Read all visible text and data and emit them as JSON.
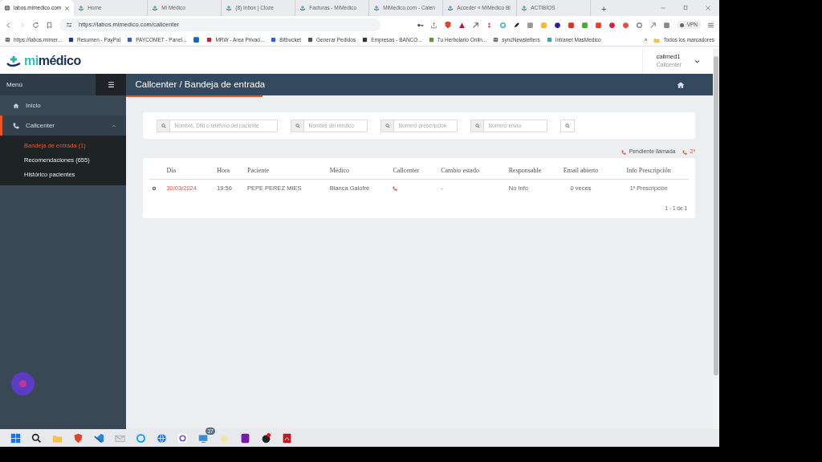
{
  "browser": {
    "tabs": [
      {
        "title": "labos.mimedico.com",
        "selected": true
      },
      {
        "title": "Home",
        "selected": false
      },
      {
        "title": "Mi Médico",
        "selected": false
      },
      {
        "title": "(8) Inbox | Cloze",
        "selected": false
      },
      {
        "title": "Facturas - MiMedico",
        "selected": false
      },
      {
        "title": "MiMedico.com - Calen",
        "selected": false
      },
      {
        "title": "Acceder « MiMedico Bl",
        "selected": false
      },
      {
        "title": "ACTIBIOS",
        "selected": false
      }
    ],
    "new_tab": "+",
    "url": "https://labos.mimedico.com/callcenter",
    "vpn": "VPN",
    "bookmarks": [
      {
        "label": "https://labos.mimer..."
      },
      {
        "label": "Resumen - PayPal"
      },
      {
        "label": "PAYCOMET - Panel..."
      },
      {
        "kind": "icon_only"
      },
      {
        "label": "MRW - Area Privad..."
      },
      {
        "label": "Bitbucket"
      },
      {
        "label": "Generar Pedidos"
      },
      {
        "label": "Empresas - BANCO..."
      },
      {
        "label": "Tu Herbolario Onlin..."
      },
      {
        "label": "syncNewsletters"
      },
      {
        "label": "Intranet MasMedico"
      }
    ],
    "more_bookmarks": "»",
    "all_bookmarks": "Todos los marcadores"
  },
  "app": {
    "logo_prefix": "mi",
    "logo_name": "médico",
    "user": {
      "name": "callmed1",
      "role": "Callcenter"
    },
    "sidebar": {
      "title": "Menú",
      "items": [
        {
          "label": "Inicio",
          "kind": "home",
          "selected": false
        },
        {
          "label": "Callcenter",
          "kind": "phone",
          "selected": true,
          "expanded": true,
          "children": [
            {
              "label": "Bandeja de entrada (1)",
              "selected": true
            },
            {
              "label": "Recomendaciones (655)",
              "selected": false
            },
            {
              "label": "Histórico pacientes",
              "selected": false
            }
          ]
        }
      ]
    },
    "page_title": "Callcenter / Bandeja de entrada",
    "filters": [
      {
        "placeholder": "Nombre, DNI o teléfono del paciente"
      },
      {
        "placeholder": "Nombre del médico"
      },
      {
        "placeholder": "Número prescripción"
      },
      {
        "placeholder": "Número envío"
      }
    ],
    "legend": [
      {
        "label": "Pendiente llamada"
      },
      {
        "label": "2ª"
      }
    ],
    "table": {
      "columns": [
        "",
        "Día",
        "Hora",
        "Paciente",
        "Médico",
        "Callcenter",
        "Cambio estado",
        "Responsable",
        "Email abierto",
        "Info Prescripción"
      ],
      "rows": [
        {
          "dia": "30/03/2024",
          "hora": "19:56",
          "paciente": "PEPE PEREZ MIES",
          "medico": "Blanca Galofré",
          "callcenter_pending": true,
          "cambio_estado": "-",
          "responsable": "No Info",
          "email_abierto": "0 veces",
          "info": "1ª Prescripción"
        }
      ]
    },
    "pagination": "1 - 1 de 1"
  },
  "taskbar": {
    "badge": "37"
  }
}
